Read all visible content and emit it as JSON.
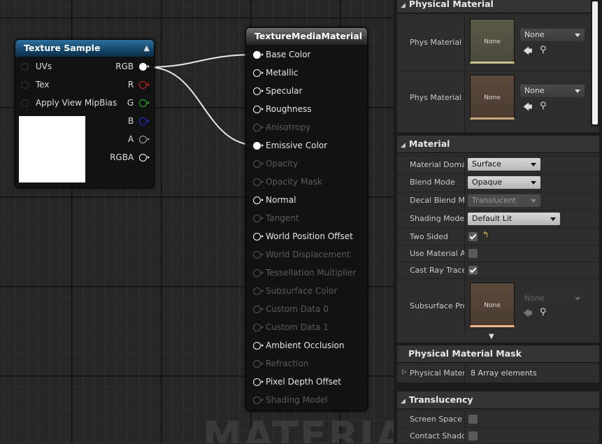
{
  "graph": {
    "watermark": "MATERIAL",
    "texture_node": {
      "title": "Texture Sample",
      "inputs": [
        "UVs",
        "Tex",
        "Apply View MipBias"
      ],
      "outputs": [
        {
          "label": "RGB",
          "color": "#ffffff"
        },
        {
          "label": "R",
          "color": "#e02020"
        },
        {
          "label": "G",
          "color": "#20c020"
        },
        {
          "label": "B",
          "color": "#2030e0"
        },
        {
          "label": "A",
          "color": "#aaaaaa"
        },
        {
          "label": "RGBA",
          "color": "#ffffff"
        }
      ]
    },
    "material_node": {
      "title": "TextureMediaMaterial",
      "pins": [
        {
          "label": "Base Color",
          "enabled": true,
          "connected": true
        },
        {
          "label": "Metallic",
          "enabled": true,
          "connected": false
        },
        {
          "label": "Specular",
          "enabled": true,
          "connected": false
        },
        {
          "label": "Roughness",
          "enabled": true,
          "connected": false
        },
        {
          "label": "Anisotropy",
          "enabled": false,
          "connected": false
        },
        {
          "label": "Emissive Color",
          "enabled": true,
          "connected": true
        },
        {
          "label": "Opacity",
          "enabled": false,
          "connected": false
        },
        {
          "label": "Opacity Mask",
          "enabled": false,
          "connected": false
        },
        {
          "label": "Normal",
          "enabled": true,
          "connected": false
        },
        {
          "label": "Tangent",
          "enabled": false,
          "connected": false
        },
        {
          "label": "World Position Offset",
          "enabled": true,
          "connected": false
        },
        {
          "label": "World Displacement",
          "enabled": false,
          "connected": false
        },
        {
          "label": "Tessellation Multiplier",
          "enabled": false,
          "connected": false
        },
        {
          "label": "Subsurface Color",
          "enabled": false,
          "connected": false
        },
        {
          "label": "Custom Data 0",
          "enabled": false,
          "connected": false
        },
        {
          "label": "Custom Data 1",
          "enabled": false,
          "connected": false
        },
        {
          "label": "Ambient Occlusion",
          "enabled": true,
          "connected": false
        },
        {
          "label": "Refraction",
          "enabled": false,
          "connected": false
        },
        {
          "label": "Pixel Depth Offset",
          "enabled": true,
          "connected": false
        },
        {
          "label": "Shading Model",
          "enabled": false,
          "connected": false
        }
      ]
    }
  },
  "details": {
    "physical_material": {
      "header": "Physical Material",
      "phys_material": {
        "label": "Phys Material",
        "thumb": "None",
        "value": "None"
      },
      "phys_material_mask": {
        "label": "Phys Material Mask",
        "thumb": "None",
        "value": "None"
      }
    },
    "material": {
      "header": "Material",
      "domain": {
        "label": "Material Domain",
        "value": "Surface"
      },
      "blend_mode": {
        "label": "Blend Mode",
        "value": "Opaque"
      },
      "decal_blend_mode": {
        "label": "Decal Blend Mode",
        "value": "Translucent"
      },
      "shading_model": {
        "label": "Shading Model",
        "value": "Default Lit"
      },
      "two_sided": {
        "label": "Two Sided",
        "checked": true
      },
      "use_material_attributes": {
        "label": "Use Material Attributes",
        "checked": false
      },
      "cast_ray_traced_shadows": {
        "label": "Cast Ray Traced Shadows",
        "checked": true
      },
      "subsurface_profile": {
        "label": "Subsurface Profile",
        "thumb": "None",
        "value": "None"
      }
    },
    "physical_material_mask": {
      "header": "Physical Material Mask",
      "row": {
        "label": "Physical Material Map",
        "value": "8 Array elements"
      }
    },
    "translucency": {
      "header": "Translucency",
      "screen_space_reflections": {
        "label": "Screen Space Reflections",
        "checked": false
      },
      "contact_shadows": {
        "label": "Contact Shadows",
        "checked": false
      }
    },
    "icons": {
      "use": "arrow-left-icon",
      "browse": "search-icon",
      "reset": "reset-arrow-icon",
      "expand": "expand-arrow-icon"
    }
  }
}
